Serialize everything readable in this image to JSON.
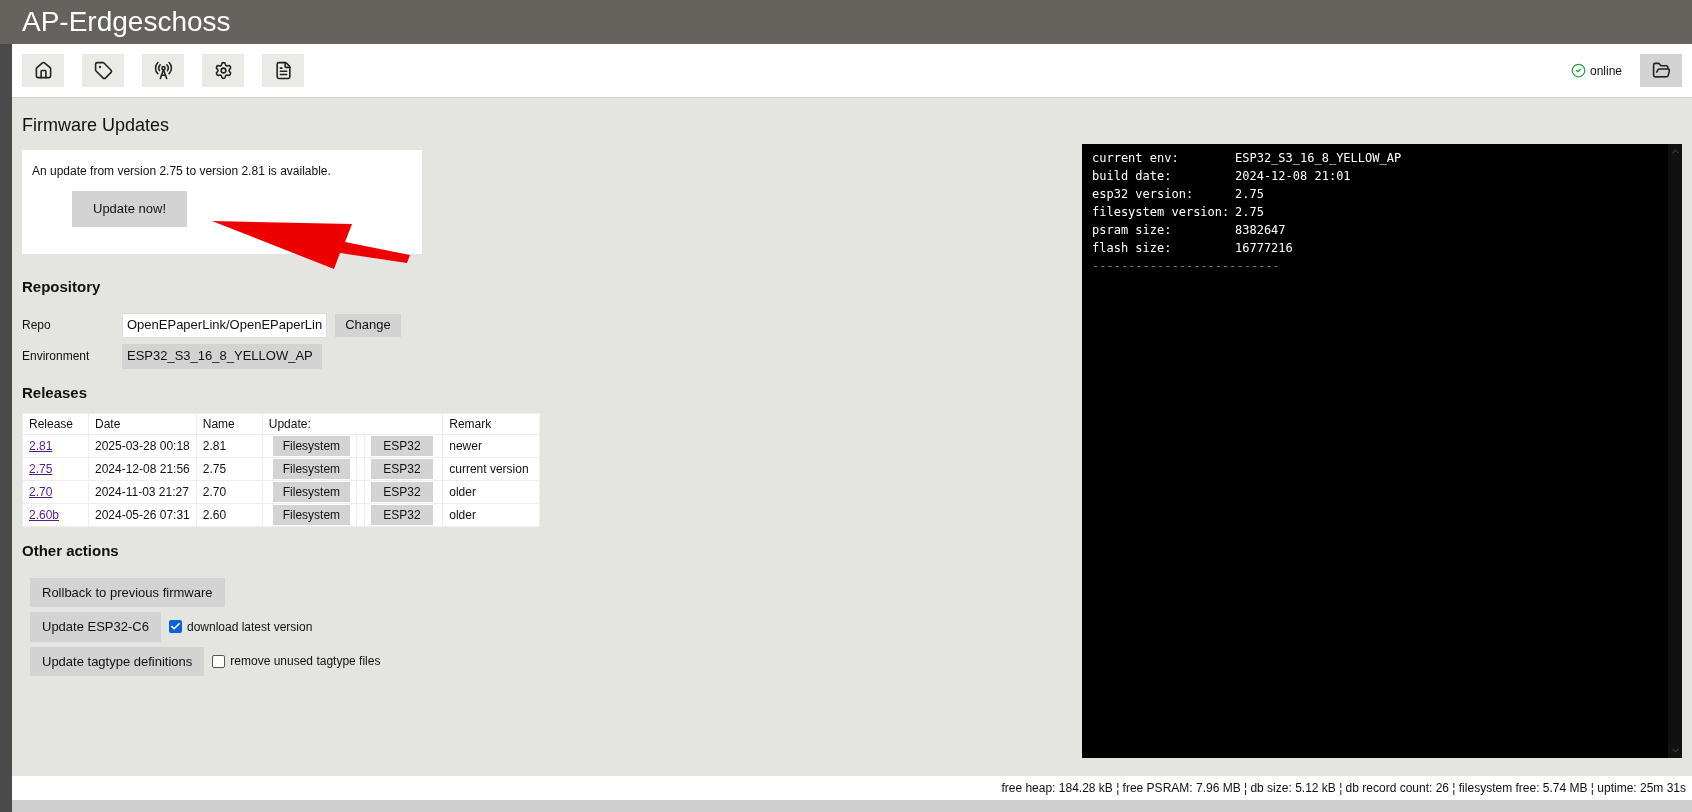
{
  "header": {
    "title": "AP-Erdgeschoss"
  },
  "toolbar": {
    "status": {
      "label": "online",
      "online": true
    }
  },
  "page": {
    "title": "Firmware Updates",
    "update_notice": {
      "text": "An update from version 2.75 to version 2.81 is available.",
      "button": "Update now!"
    },
    "repository": {
      "heading": "Repository",
      "repo_label": "Repo",
      "repo_value": "OpenEPaperLink/OpenEPaperLin",
      "change_button": "Change",
      "env_label": "Environment",
      "env_value": "ESP32_S3_16_8_YELLOW_AP"
    },
    "releases": {
      "heading": "Releases",
      "columns": [
        "Release",
        "Date",
        "Name",
        "Update:",
        "Remark"
      ],
      "rows": [
        {
          "release": "2.81",
          "date": "2025-03-28 00:18",
          "name": "2.81",
          "fs_button": "Filesystem",
          "esp_button": "ESP32",
          "remark": "newer"
        },
        {
          "release": "2.75",
          "date": "2024-12-08 21:56",
          "name": "2.75",
          "fs_button": "Filesystem",
          "esp_button": "ESP32",
          "remark": "current version"
        },
        {
          "release": "2.70",
          "date": "2024-11-03 21:27",
          "name": "2.70",
          "fs_button": "Filesystem",
          "esp_button": "ESP32",
          "remark": "older"
        },
        {
          "release": "2.60b",
          "date": "2024-05-26 07:31",
          "name": "2.60",
          "fs_button": "Filesystem",
          "esp_button": "ESP32",
          "remark": "older"
        }
      ]
    },
    "other_actions": {
      "heading": "Other actions",
      "actions": [
        {
          "button": "Rollback to previous firmware"
        },
        {
          "button": "Update ESP32-C6",
          "checkbox": {
            "label": "download latest version",
            "checked": true
          }
        },
        {
          "button": "Update tagtype definitions",
          "checkbox": {
            "label": "remove unused tagtype files",
            "checked": false
          }
        }
      ]
    }
  },
  "console": {
    "lines": [
      {
        "label": "current env:",
        "value": "ESP32_S3_16_8_YELLOW_AP"
      },
      {
        "label": "build date:",
        "value": "2024-12-08 21:01"
      },
      {
        "label": "esp32 version:",
        "value": "2.75"
      },
      {
        "label": "filesystem version:",
        "value": "2.75"
      },
      {
        "label": "psram size:",
        "value": "8382647"
      },
      {
        "label": "flash size:",
        "value": "16777216"
      }
    ],
    "separator": "--------------------------"
  },
  "status_bar": "free heap: 184.28 kB ¦ free PSRAM: 7.96 MB ¦ db size: 5.12 kB ¦ db record count: 26 ¦ filesystem free: 5.74 MB ¦ uptime: 25m 31s"
}
